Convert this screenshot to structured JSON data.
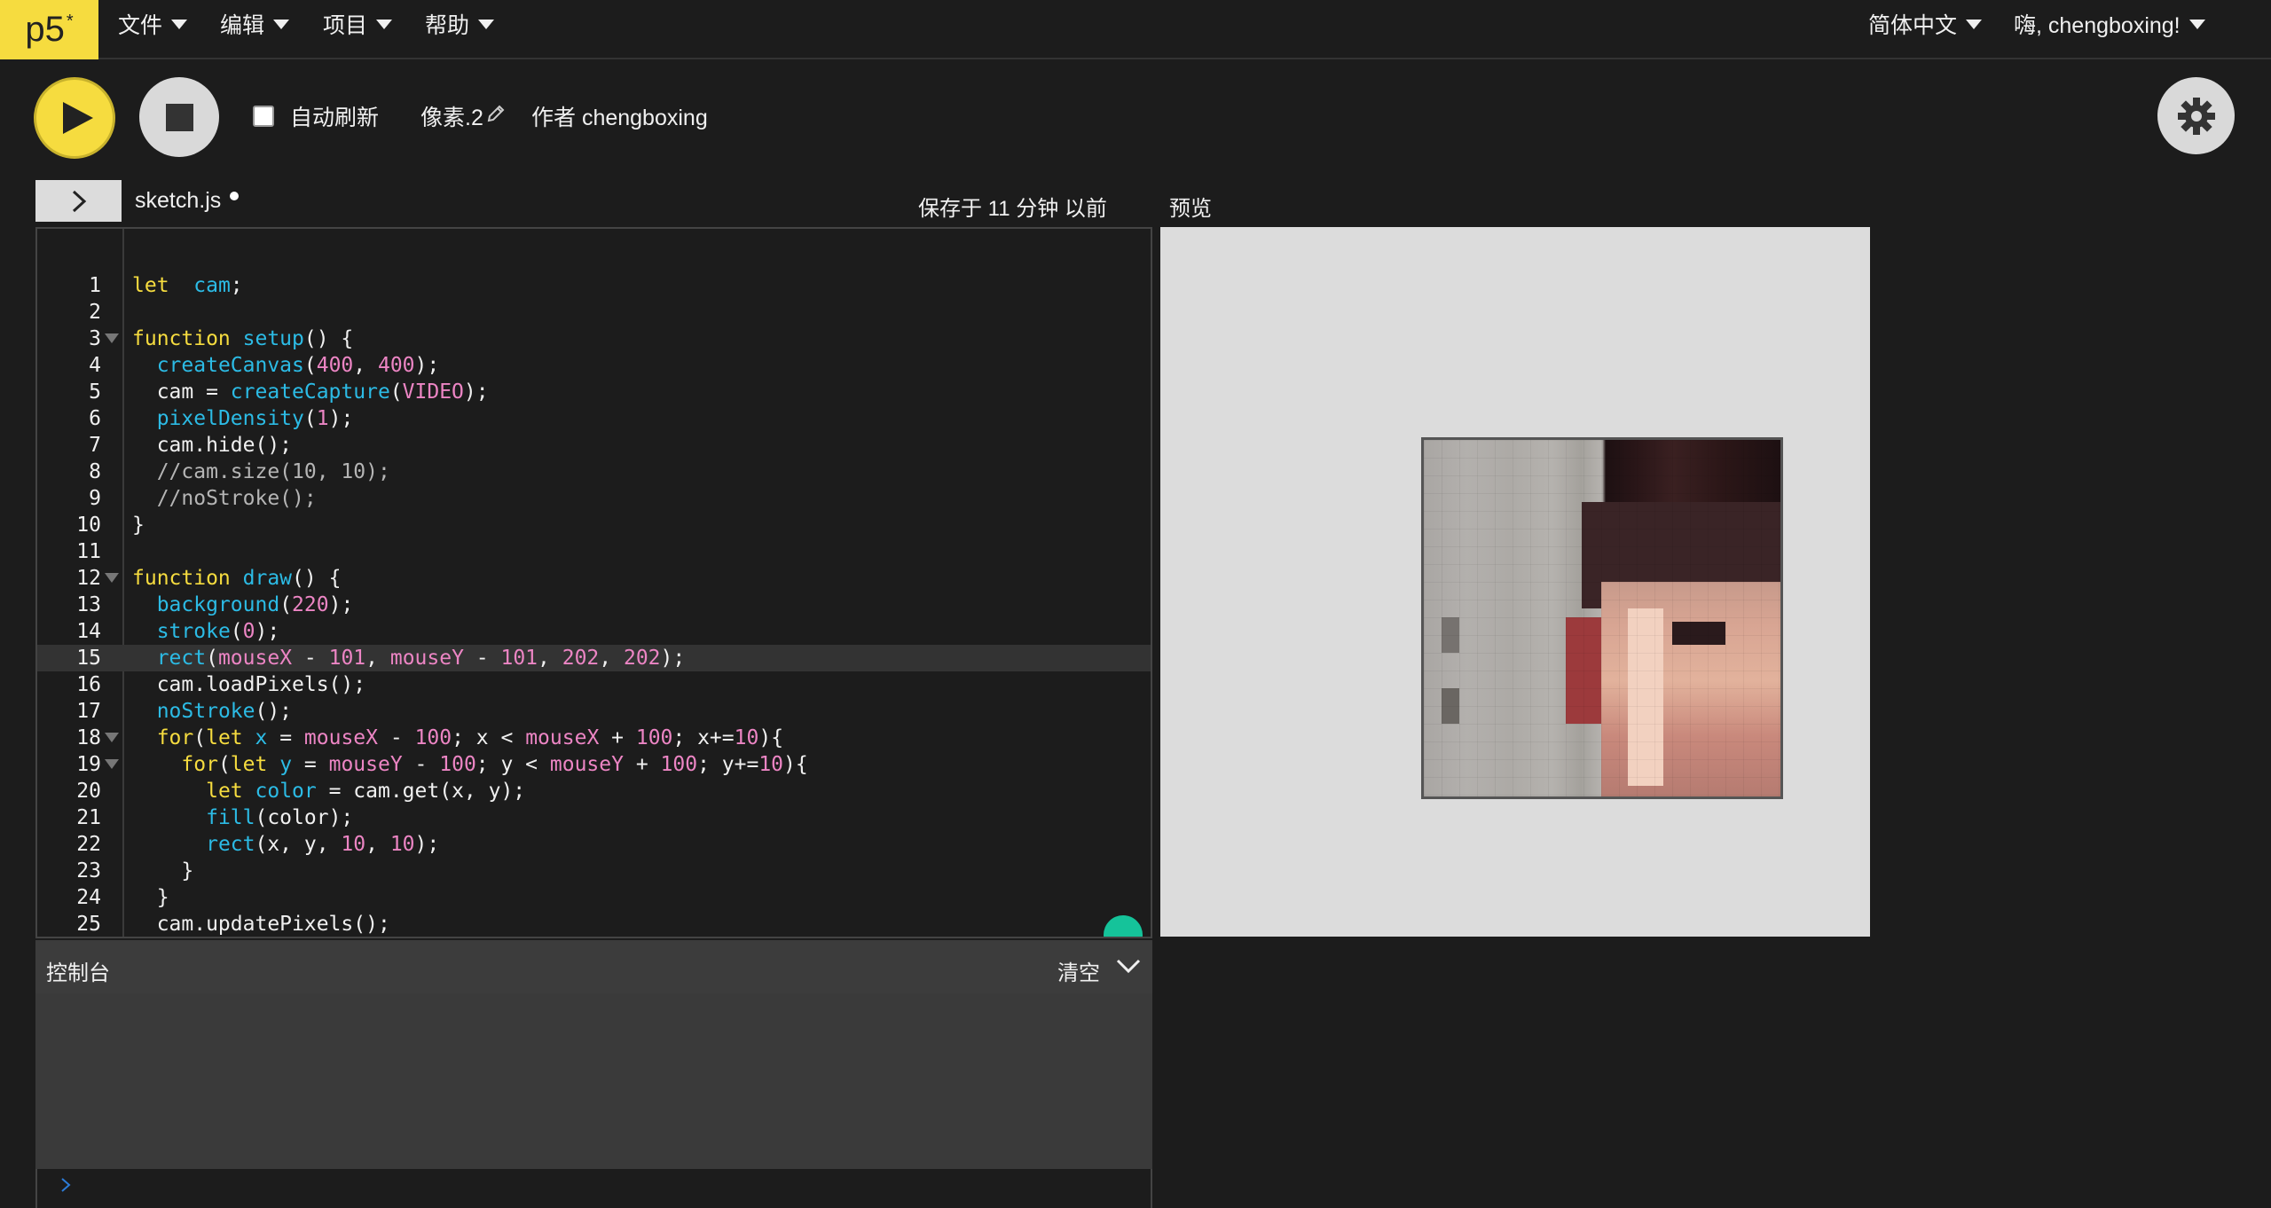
{
  "logo": {
    "text": "p5",
    "sup": "*"
  },
  "menu": {
    "file": "文件",
    "edit": "编辑",
    "project": "项目",
    "help": "帮助",
    "language": "简体中文",
    "user": "嗨, chengboxing!"
  },
  "toolbar": {
    "auto_refresh": "自动刷新",
    "sketch_name": "像素.2",
    "author": "作者 chengboxing"
  },
  "editor": {
    "filename": "sketch.js",
    "saved": "保存于 11 分钟 以前",
    "active_line": 15
  },
  "preview": {
    "label": "预览"
  },
  "console": {
    "title": "控制台",
    "clear": "清空"
  },
  "code": [
    {
      "n": "1",
      "tokens": [
        [
          "kw",
          "let"
        ],
        [
          "",
          "  "
        ],
        [
          "fn",
          "cam"
        ],
        [
          "",
          ";"
        ]
      ]
    },
    {
      "n": "2",
      "tokens": []
    },
    {
      "n": "3",
      "fold": true,
      "tokens": [
        [
          "kw",
          "function"
        ],
        [
          "",
          " "
        ],
        [
          "fn",
          "setup"
        ],
        [
          "",
          "() {"
        ]
      ]
    },
    {
      "n": "4",
      "tokens": [
        [
          "",
          "  "
        ],
        [
          "fn",
          "createCanvas"
        ],
        [
          "",
          "("
        ],
        [
          "num",
          "400"
        ],
        [
          "",
          ", "
        ],
        [
          "num",
          "400"
        ],
        [
          "",
          ");"
        ]
      ]
    },
    {
      "n": "5",
      "tokens": [
        [
          "",
          "  cam = "
        ],
        [
          "fn",
          "createCapture"
        ],
        [
          "",
          "("
        ],
        [
          "num",
          "VIDEO"
        ],
        [
          "",
          ");"
        ]
      ]
    },
    {
      "n": "6",
      "tokens": [
        [
          "",
          "  "
        ],
        [
          "fn",
          "pixelDensity"
        ],
        [
          "",
          "("
        ],
        [
          "num",
          "1"
        ],
        [
          "",
          ");"
        ]
      ]
    },
    {
      "n": "7",
      "tokens": [
        [
          "",
          "  cam.hide();"
        ]
      ]
    },
    {
      "n": "8",
      "tokens": [
        [
          "cm",
          "  //cam.size(10, 10);"
        ]
      ]
    },
    {
      "n": "9",
      "tokens": [
        [
          "cm",
          "  //noStroke();"
        ]
      ]
    },
    {
      "n": "10",
      "tokens": [
        [
          "",
          "}"
        ]
      ]
    },
    {
      "n": "11",
      "tokens": []
    },
    {
      "n": "12",
      "fold": true,
      "tokens": [
        [
          "kw",
          "function"
        ],
        [
          "",
          " "
        ],
        [
          "fn",
          "draw"
        ],
        [
          "",
          "() {"
        ]
      ]
    },
    {
      "n": "13",
      "tokens": [
        [
          "",
          "  "
        ],
        [
          "fn",
          "background"
        ],
        [
          "",
          "("
        ],
        [
          "num",
          "220"
        ],
        [
          "",
          ");"
        ]
      ]
    },
    {
      "n": "14",
      "tokens": [
        [
          "",
          "  "
        ],
        [
          "fn",
          "stroke"
        ],
        [
          "",
          "("
        ],
        [
          "num",
          "0"
        ],
        [
          "",
          ");"
        ]
      ]
    },
    {
      "n": "15",
      "tokens": [
        [
          "",
          "  "
        ],
        [
          "fn",
          "rect"
        ],
        [
          "",
          "("
        ],
        [
          "num",
          "mouseX"
        ],
        [
          "",
          " - "
        ],
        [
          "num",
          "101"
        ],
        [
          "",
          ", "
        ],
        [
          "num",
          "mouseY"
        ],
        [
          "",
          " - "
        ],
        [
          "num",
          "101"
        ],
        [
          "",
          ", "
        ],
        [
          "num",
          "202"
        ],
        [
          "",
          ", "
        ],
        [
          "num",
          "202"
        ],
        [
          "",
          ");"
        ]
      ]
    },
    {
      "n": "16",
      "tokens": [
        [
          "",
          "  cam.loadPixels();"
        ]
      ]
    },
    {
      "n": "17",
      "tokens": [
        [
          "",
          "  "
        ],
        [
          "fn",
          "noStroke"
        ],
        [
          "",
          "();"
        ]
      ]
    },
    {
      "n": "18",
      "fold": true,
      "tokens": [
        [
          "",
          "  "
        ],
        [
          "kw",
          "for"
        ],
        [
          "",
          "("
        ],
        [
          "kw",
          "let"
        ],
        [
          "",
          " "
        ],
        [
          "fn",
          "x"
        ],
        [
          "",
          " = "
        ],
        [
          "num",
          "mouseX"
        ],
        [
          "",
          " - "
        ],
        [
          "num",
          "100"
        ],
        [
          "",
          "; x < "
        ],
        [
          "num",
          "mouseX"
        ],
        [
          "",
          " + "
        ],
        [
          "num",
          "100"
        ],
        [
          "",
          "; x+="
        ],
        [
          "num",
          "10"
        ],
        [
          "",
          "){"
        ]
      ]
    },
    {
      "n": "19",
      "fold": true,
      "tokens": [
        [
          "",
          "    "
        ],
        [
          "kw",
          "for"
        ],
        [
          "",
          "("
        ],
        [
          "kw",
          "let"
        ],
        [
          "",
          " "
        ],
        [
          "fn",
          "y"
        ],
        [
          "",
          " = "
        ],
        [
          "num",
          "mouseY"
        ],
        [
          "",
          " - "
        ],
        [
          "num",
          "100"
        ],
        [
          "",
          "; y < "
        ],
        [
          "num",
          "mouseY"
        ],
        [
          "",
          " + "
        ],
        [
          "num",
          "100"
        ],
        [
          "",
          "; y+="
        ],
        [
          "num",
          "10"
        ],
        [
          "",
          "){"
        ]
      ]
    },
    {
      "n": "20",
      "tokens": [
        [
          "",
          "      "
        ],
        [
          "kw",
          "let"
        ],
        [
          "",
          " "
        ],
        [
          "fn",
          "color"
        ],
        [
          "",
          " = cam.get(x, y);"
        ]
      ]
    },
    {
      "n": "21",
      "tokens": [
        [
          "",
          "      "
        ],
        [
          "fn",
          "fill"
        ],
        [
          "",
          "(color);"
        ]
      ]
    },
    {
      "n": "22",
      "tokens": [
        [
          "",
          "      "
        ],
        [
          "fn",
          "rect"
        ],
        [
          "",
          "(x, y, "
        ],
        [
          "num",
          "10"
        ],
        [
          "",
          ", "
        ],
        [
          "num",
          "10"
        ],
        [
          "",
          ");"
        ]
      ]
    },
    {
      "n": "23",
      "tokens": [
        [
          "",
          "    }"
        ]
      ]
    },
    {
      "n": "24",
      "tokens": [
        [
          "",
          "  }"
        ]
      ]
    },
    {
      "n": "25",
      "tokens": [
        [
          "",
          "  cam.updatePixels();"
        ]
      ]
    }
  ]
}
